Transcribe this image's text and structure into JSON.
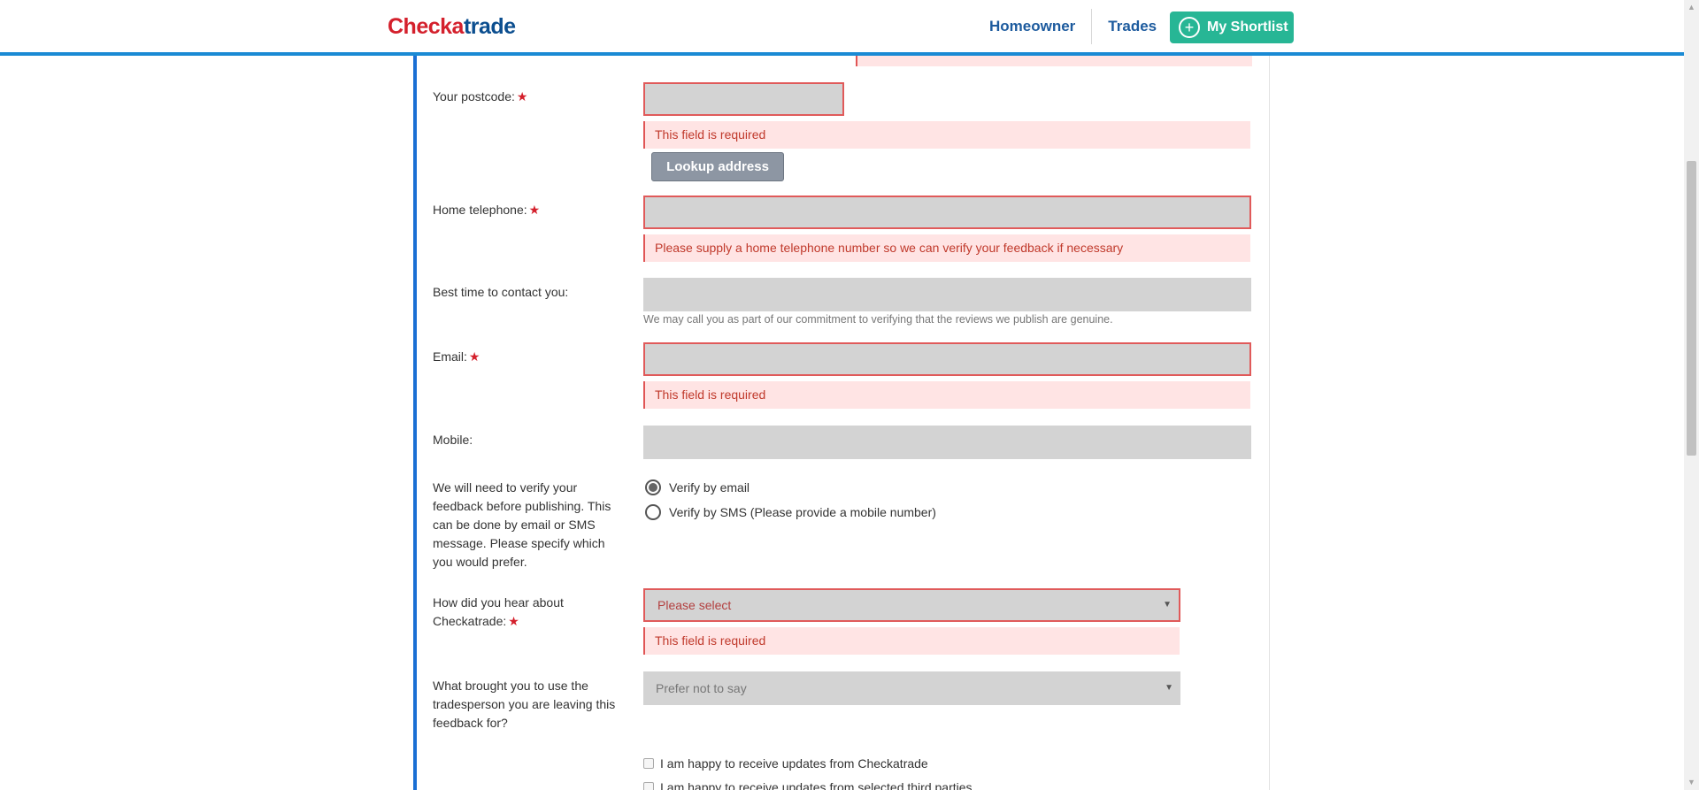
{
  "header": {
    "logo_part1": "Check",
    "logo_part2": "a",
    "logo_part3": "trade",
    "nav": {
      "homeowner": "Homeowner",
      "trades": "Trades",
      "shortlist": "My Shortlist",
      "shortlist_icon": "plus-circle-icon"
    }
  },
  "form": {
    "postcode": {
      "label": "Your postcode:",
      "required_mark": "★",
      "value": "",
      "error": "This field is required",
      "lookup_button": "Lookup address"
    },
    "home_telephone": {
      "label": "Home telephone:",
      "required_mark": "★",
      "value": "",
      "error": "Please supply a home telephone number so we can verify your feedback if necessary"
    },
    "best_time": {
      "label": "Best time to contact you:",
      "value": "",
      "hint": "We may call you as part of our commitment to verifying that the reviews we publish are genuine."
    },
    "email": {
      "label": "Email:",
      "required_mark": "★",
      "value": "",
      "error": "This field is required"
    },
    "mobile": {
      "label": "Mobile:",
      "value": ""
    },
    "verify": {
      "label_line1": "We will need to verify your",
      "label_line2": "feedback before publishing. This",
      "label_line3": "can be done by email or SMS",
      "label_line4": "message. Please specify which",
      "label_line5": "you would prefer.",
      "options": [
        {
          "label": "Verify by email",
          "selected": true
        },
        {
          "label": "Verify by SMS (Please provide a mobile number)",
          "selected": false
        }
      ]
    },
    "hear_about": {
      "label_line1": "How did you hear about",
      "label_line2": "Checkatrade:",
      "required_mark": "★",
      "selected": "Please select",
      "error": "This field is required"
    },
    "what_brought": {
      "label_line1": "What brought you to use the",
      "label_line2": "tradesperson you are leaving this",
      "label_line3": "feedback for?",
      "selected": "Prefer not to say"
    },
    "checkboxes": [
      {
        "label": "I am happy to receive updates from Checkatrade",
        "checked": false
      },
      {
        "label": "I am happy to receive updates from selected third parties",
        "checked": false
      }
    ]
  },
  "colors": {
    "brand_red": "#d4202c",
    "brand_blue": "#0b4e8f",
    "accent_green": "#27b695",
    "error_bg": "#ffe4e4",
    "error_border": "#e05555"
  }
}
